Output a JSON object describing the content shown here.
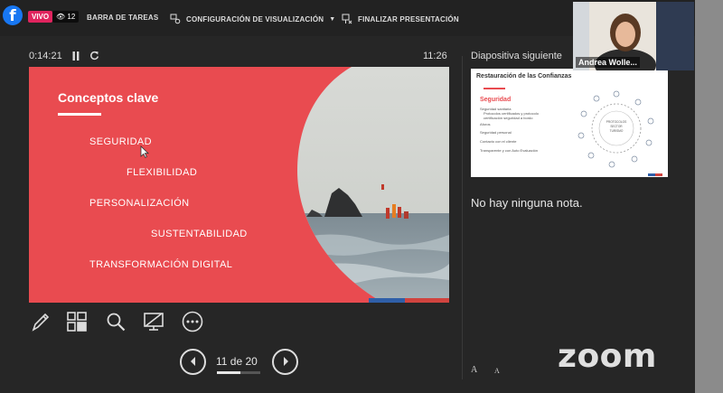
{
  "stream": {
    "live_badge": "VIVO",
    "viewer_count": "12"
  },
  "toolbar": {
    "taskbar_label": "BARRA DE TAREAS",
    "display_settings_label": "CONFIGURACIÓN DE VISUALIZACIÓN",
    "end_presentation_label": "FINALIZAR PRESENTACIÓN"
  },
  "presenter": {
    "elapsed_time": "0:14:21",
    "clock": "11:26",
    "current_slide": {
      "title": "Conceptos clave",
      "concepts": [
        "SEGURIDAD",
        "FLEXIBILIDAD",
        "PERSONALIZACIÓN",
        "SUSTENTABILIDAD",
        "TRANSFORMACIÓN DIGITAL"
      ]
    },
    "page_indicator": "11 de 20",
    "progress_fraction": 0.55,
    "next_slide_label": "Diapositiva siguiente",
    "next_slide": {
      "title": "Restauración de las Confianzas",
      "subtitle": "Seguridad",
      "bullets": [
        "Seguridad sanitaria",
        "Protocolos certificados y protocolo",
        "certificación seguridad a bordo",
        "Aforos",
        "Seguridad personal",
        "Contacto con el cliente",
        "Transparente y con Auto Evaluación"
      ],
      "diagram_center": [
        "PROTOCOLOS",
        "SECTOR",
        "TURISMO"
      ]
    },
    "notes_text": "No hay ninguna nota.",
    "font_increase_label": "A",
    "font_decrease_label": "A"
  },
  "webcam": {
    "participant_name": "Andrea Wolle..."
  },
  "branding": {
    "zoom_logo_text": "zoom"
  },
  "colors": {
    "slide_red": "#e94b50",
    "facebook_blue": "#1877f2",
    "live_red": "#e0245e",
    "background": "#262626"
  }
}
